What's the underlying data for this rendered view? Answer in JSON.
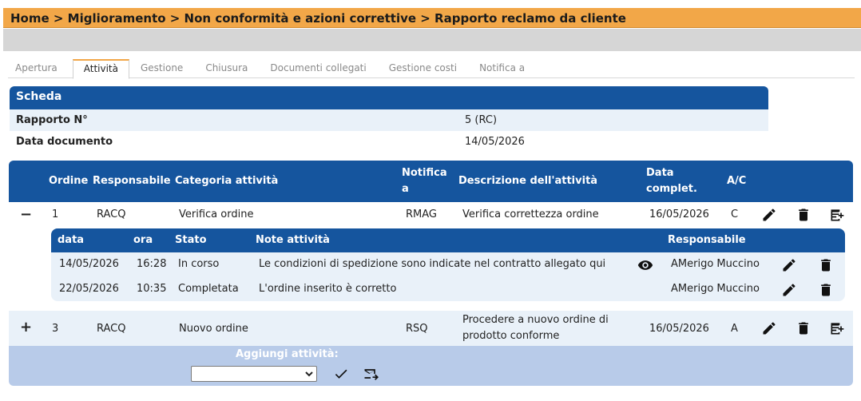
{
  "breadcrumb": "Home > Miglioramento > Non conformità e azioni correttive > Rapporto reclamo da cliente",
  "tabs": [
    "Apertura",
    "Attività",
    "Gestione",
    "Chiusura",
    "Documenti collegati",
    "Gestione costi",
    "Notifica a"
  ],
  "active_tab": "Attività",
  "scheda": {
    "title": "Scheda",
    "rows": [
      {
        "label": "Rapporto N°",
        "value": "5 (RC)"
      },
      {
        "label": "Data documento",
        "value": "14/05/2026"
      }
    ]
  },
  "activities": {
    "headers": {
      "ordine": "Ordine",
      "responsabile": "Responsabile",
      "categoria": "Categoria attività",
      "notifica_1": "Notifica",
      "notifica_2": "a",
      "descrizione": "Descrizione dell'attività",
      "data_1": "Data",
      "data_2": "complet.",
      "ac": "A/C"
    },
    "rows": [
      {
        "toggle": "−",
        "ordine": "1",
        "responsabile": "RACQ",
        "categoria": "Verifica ordine",
        "notifica": "RMAG",
        "descrizione": "Verifica correttezza ordine",
        "descrizione_2": "",
        "data": "16/05/2026",
        "ac": "C"
      },
      {
        "toggle": "+",
        "ordine": "3",
        "responsabile": "RACQ",
        "categoria": "Nuovo ordine",
        "notifica": "RSQ",
        "descrizione": "Procedere a nuovo ordine di",
        "descrizione_2": "prodotto conforme",
        "data": "16/05/2026",
        "ac": "A"
      }
    ],
    "notes": {
      "headers": {
        "data": "data",
        "ora": "ora",
        "stato": "Stato",
        "note": "Note attività",
        "responsabile": "Responsabile"
      },
      "rows": [
        {
          "data": "14/05/2026",
          "ora": "16:28",
          "stato": "In corso",
          "note": "Le condizioni di spedizione sono indicate nel contratto allegato qui",
          "responsabile": "AMerigo Muccino"
        },
        {
          "data": "22/05/2026",
          "ora": "10:35",
          "stato": "Completata",
          "note": "L'ordine inserito è corretto",
          "responsabile": "AMerigo Muccino"
        }
      ]
    },
    "add": {
      "label": "Aggiungi attività:",
      "selected": ""
    }
  },
  "colors": {
    "accent": "#f2a748",
    "header_blue": "#15559e",
    "row_alt": "#e9f1f9",
    "add_bar": "#b8cbe9"
  }
}
